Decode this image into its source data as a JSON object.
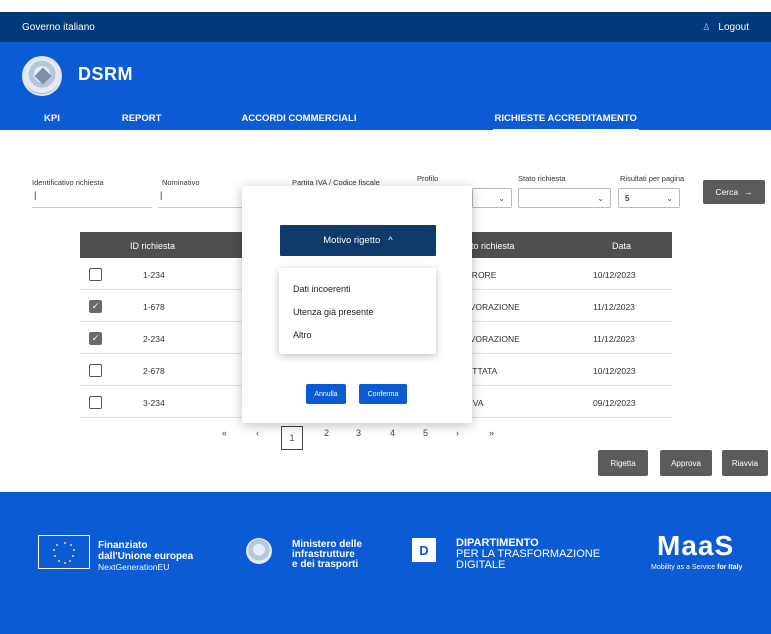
{
  "topbar": {
    "gov_label": "Governo italiano",
    "logout_label": "Logout",
    "user_icon": "user-icon"
  },
  "header": {
    "brand": "DSRM"
  },
  "nav": {
    "tabs": [
      {
        "label": "KPI"
      },
      {
        "label": "REPORT"
      },
      {
        "label": "ACCORDI COMMERCIALI"
      },
      {
        "label": "RICHIESTE ACCREDITAMENTO",
        "active": true
      }
    ]
  },
  "filters": {
    "id_label": "Identificativo richiesta",
    "id_value": "|",
    "nominativo_label": "Nominativo",
    "nominativo_value": "|",
    "piva_label": "Partita IVA / Codice fiscale",
    "profilo_label": "Profilo",
    "stato_label": "Stato richiesta",
    "risultati_label": "Risultati per pagina",
    "risultati_value": "5",
    "cerca_label": "Cerca",
    "cerca_arrow": "→"
  },
  "table": {
    "columns": {
      "id": "ID richiesta",
      "stato": "ato richiesta",
      "data": "Data"
    },
    "rows": [
      {
        "checked": false,
        "id": "1-234",
        "stato": "ERRORE",
        "data": "10/12/2023"
      },
      {
        "checked": true,
        "id": "1-678",
        "stato": "LAVORAZIONE",
        "data": "11/12/2023"
      },
      {
        "checked": true,
        "id": "2-234",
        "stato": "LAVORAZIONE",
        "data": "11/12/2023"
      },
      {
        "checked": false,
        "id": "2-678",
        "stato": "GETTATA",
        "data": "10/12/2023"
      },
      {
        "checked": false,
        "id": "3-234",
        "stato": "TTIVA",
        "data": "09/12/2023"
      }
    ]
  },
  "pagination": {
    "first": "«",
    "prev": "‹",
    "pages": [
      "1",
      "2",
      "3",
      "4",
      "5"
    ],
    "current": "1",
    "next": "›",
    "last": "»"
  },
  "actions": {
    "rigetta": "Rigetta",
    "approva": "Approva",
    "riavvia": "Riavvia"
  },
  "modal": {
    "motivo_label": "Motivo rigetto",
    "chevron": "^",
    "options": [
      "Dati incoerenti",
      "Utenza già presente",
      "Altro"
    ],
    "annulla": "Annulla",
    "conferma": "Conferma"
  },
  "footer": {
    "eu_line1": "Finanziato",
    "eu_line2": "dall'Unione europea",
    "eu_line3": "NextGenerationEU",
    "mit_line1": "Ministero delle",
    "mit_line2": "infrastrutture",
    "mit_line3": "e dei trasporti",
    "dip_box": "D",
    "dip_line1": "DIPARTIMENTO",
    "dip_line2": "PER LA TRASFORMAZIONE",
    "dip_line3": "DIGITALE",
    "maas_logo": "MaaS",
    "maas_sub1": "Mobility as a Service",
    "maas_sub2": "for Italy"
  }
}
